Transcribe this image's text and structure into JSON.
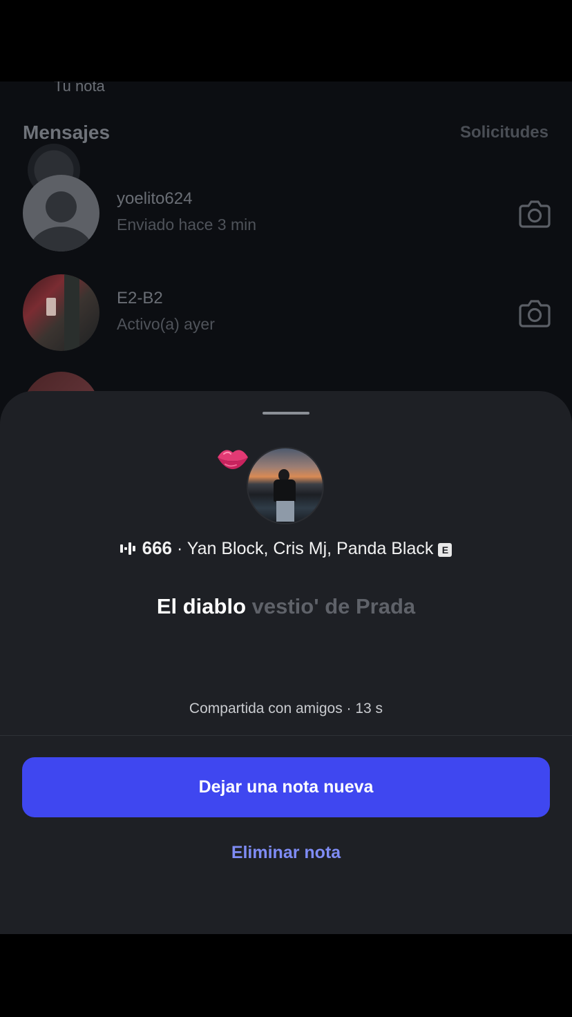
{
  "inbox": {
    "note_label": "Tu nota",
    "section_title": "Mensajes",
    "requests_label": "Solicitudes",
    "conversations": [
      {
        "name": "yoelito624",
        "status": "Enviado hace 3 min"
      },
      {
        "name": "E2-B2",
        "status": "Activo(a) ayer"
      }
    ]
  },
  "note_sheet": {
    "emoji": "lips",
    "song": {
      "title": "666",
      "separator": " · ",
      "artists": "Yan Block, Cris Mj, Panda Black",
      "explicit_badge": "E"
    },
    "lyric": {
      "current": "El diablo",
      "upcoming": " vestio' de Prada"
    },
    "shared_meta": "Compartida con amigos · 13 s",
    "primary_button": "Dejar una nota nueva",
    "delete_link": "Eliminar nota"
  },
  "colors": {
    "sheet_bg": "#1e2025",
    "primary_button": "#3f47f0",
    "delete_link": "#7f8cf5"
  }
}
